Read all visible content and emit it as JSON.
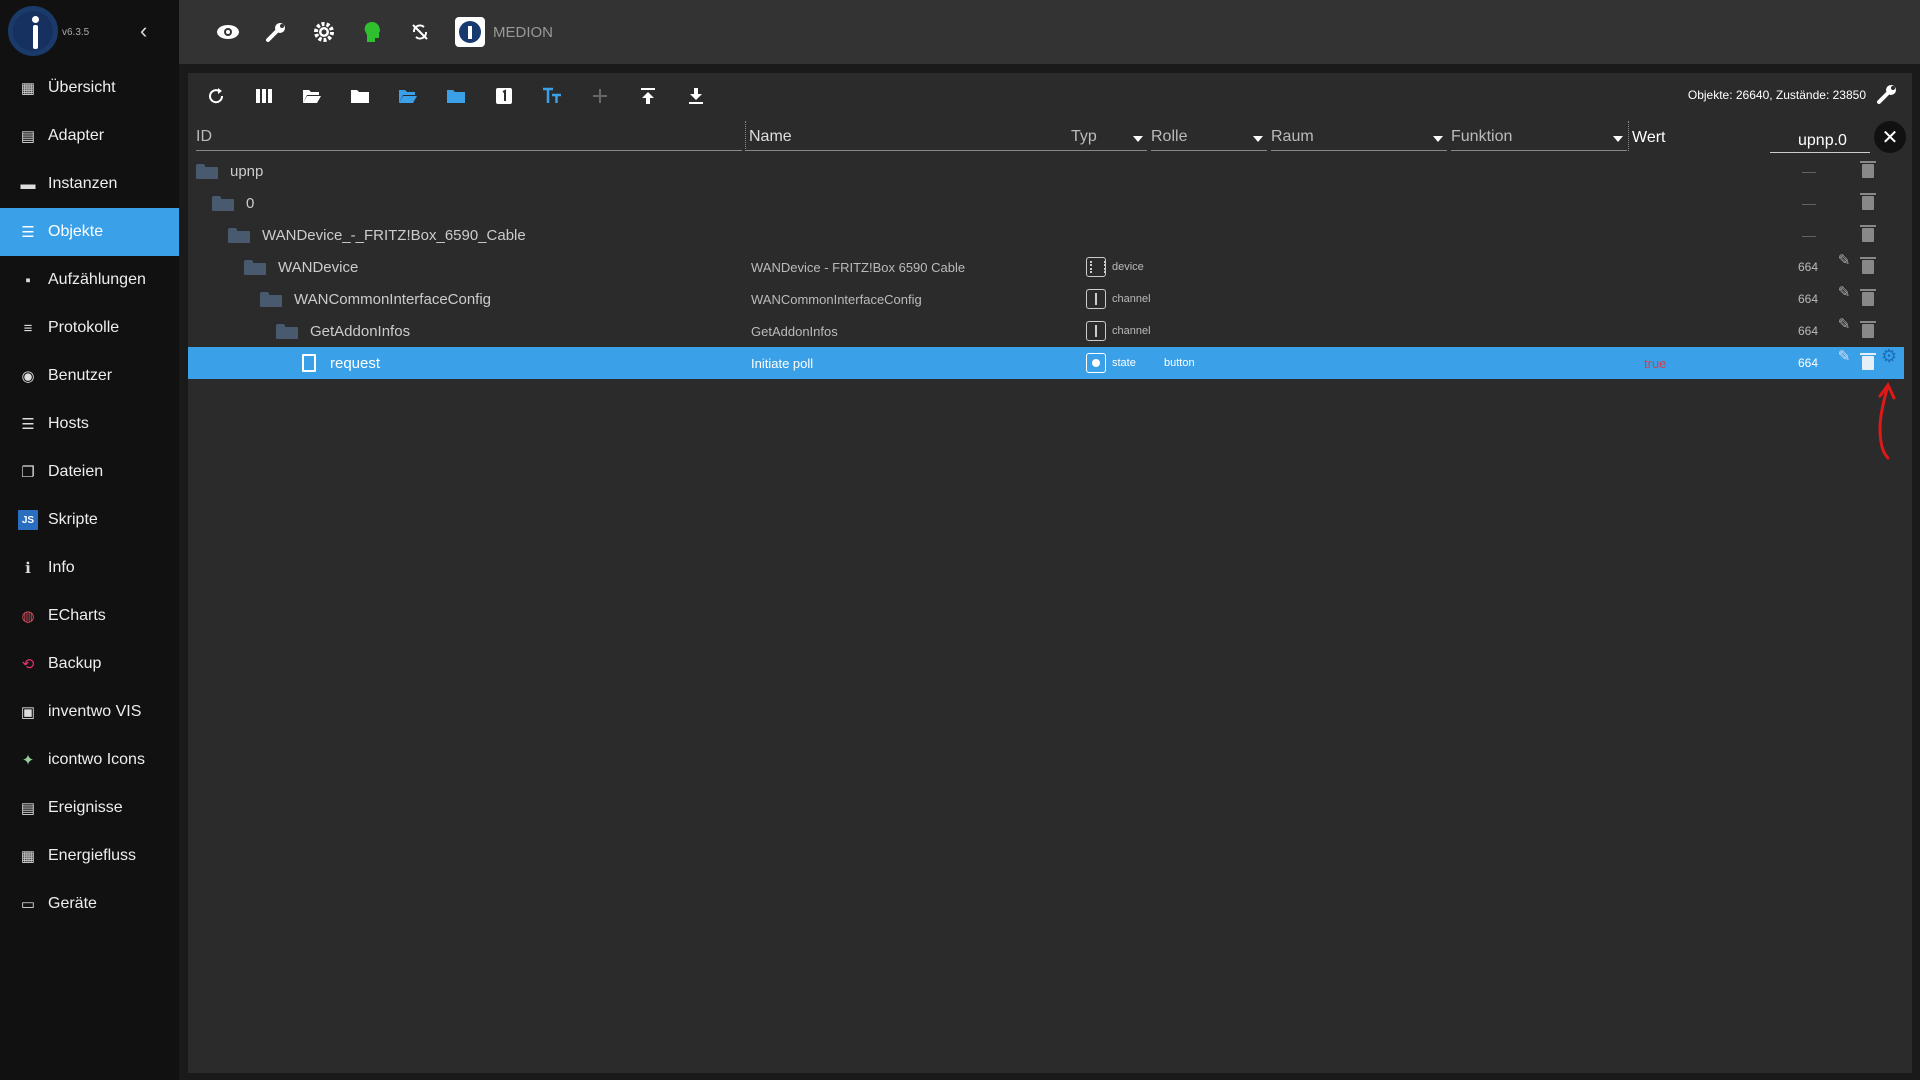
{
  "app": {
    "version": "v6.3.5",
    "host_name": "MEDION"
  },
  "sidebar": {
    "items": [
      {
        "label": "Übersicht",
        "icon": "grid-icon"
      },
      {
        "label": "Adapter",
        "icon": "store-icon"
      },
      {
        "label": "Instanzen",
        "icon": "instances-icon"
      },
      {
        "label": "Objekte",
        "icon": "list-icon",
        "active": true
      },
      {
        "label": "Aufzählungen",
        "icon": "enum-icon"
      },
      {
        "label": "Protokolle",
        "icon": "log-icon"
      },
      {
        "label": "Benutzer",
        "icon": "user-icon"
      },
      {
        "label": "Hosts",
        "icon": "hosts-icon"
      },
      {
        "label": "Dateien",
        "icon": "files-icon"
      },
      {
        "label": "Skripte",
        "icon": "js-icon"
      },
      {
        "label": "Info",
        "icon": "info-icon"
      },
      {
        "label": "ECharts",
        "icon": "echarts-icon"
      },
      {
        "label": "Backup",
        "icon": "backup-icon"
      },
      {
        "label": "inventwo VIS",
        "icon": "inventwo-icon"
      },
      {
        "label": "icontwo Icons",
        "icon": "icontwo-icon"
      },
      {
        "label": "Ereignisse",
        "icon": "events-icon"
      },
      {
        "label": "Energiefluss",
        "icon": "energy-icon"
      },
      {
        "label": "Geräte",
        "icon": "devices-icon"
      }
    ]
  },
  "objects": {
    "stats": "Objekte: 26640, Zustände: 23850",
    "columns": {
      "id": "ID",
      "name": "Name",
      "type": "Typ",
      "role": "Rolle",
      "room": "Raum",
      "function": "Funktion",
      "value": "Wert"
    },
    "filter_value": "upnp.0",
    "rows": [
      {
        "id": "upnp",
        "name": "",
        "type": "",
        "role": "",
        "value": "",
        "acl": "—",
        "kind": "folder"
      },
      {
        "id": "0",
        "name": "",
        "type": "",
        "role": "",
        "value": "",
        "acl": "—",
        "kind": "folder"
      },
      {
        "id": "WANDevice_-_FRITZ!Box_6590_Cable",
        "name": "",
        "type": "",
        "role": "",
        "value": "",
        "acl": "—",
        "kind": "folder"
      },
      {
        "id": "WANDevice",
        "name": "WANDevice - FRITZ!Box 6590 Cable",
        "type": "device",
        "role": "",
        "value": "",
        "acl": "664",
        "kind": "folder"
      },
      {
        "id": "WANCommonInterfaceConfig",
        "name": "WANCommonInterfaceConfig",
        "type": "channel",
        "role": "",
        "value": "",
        "acl": "664",
        "kind": "folder"
      },
      {
        "id": "GetAddonInfos",
        "name": "GetAddonInfos",
        "type": "channel",
        "role": "",
        "value": "",
        "acl": "664",
        "kind": "folder"
      },
      {
        "id": "request",
        "name": "Initiate poll",
        "type": "state",
        "role": "button",
        "value": "true",
        "acl": "664",
        "kind": "file"
      }
    ]
  },
  "colors": {
    "accent": "#3aa0e8",
    "sidebar_bg": "#111111",
    "panel_bg": "#2b2b2b",
    "topbar_bg": "#333333",
    "value_true": "#d04050"
  }
}
